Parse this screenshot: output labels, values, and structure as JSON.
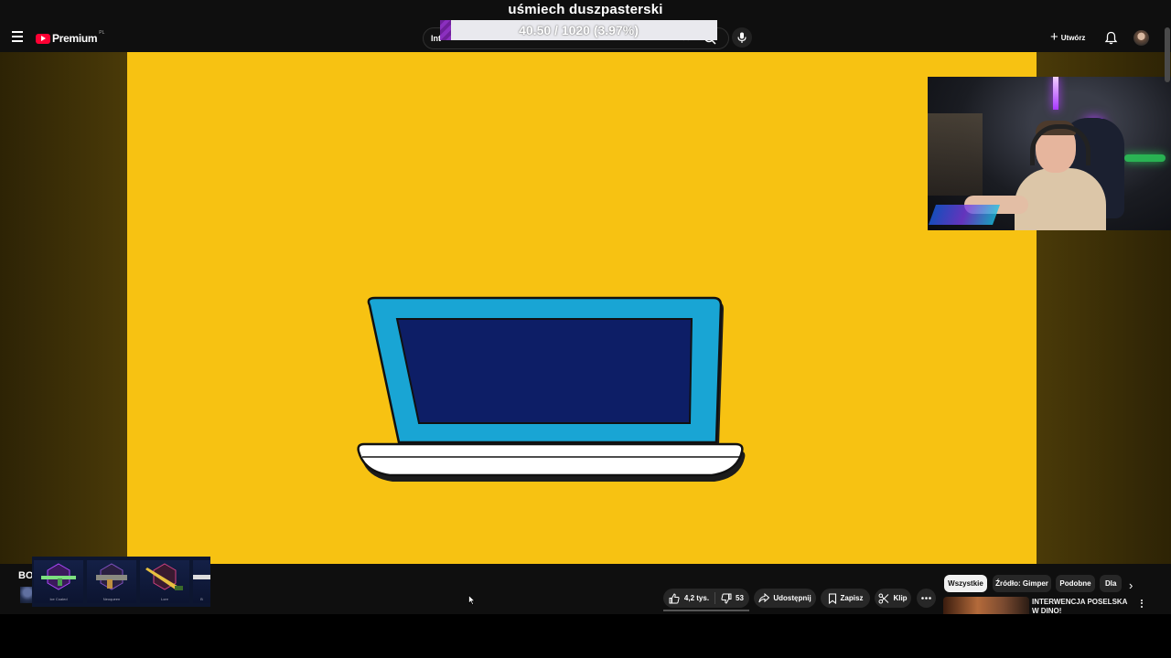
{
  "overlay": {
    "title": "uśmiech duszpasterski",
    "goal_text": "40.50 / 1020 (3.97%)",
    "goal_fraction": 0.0397,
    "goal_fill_color": "#7b2aa9"
  },
  "header": {
    "logo_text": "Premium",
    "logo_region": "PL",
    "search_value": "Int",
    "create_label": "Utwórz"
  },
  "video": {
    "background_color": "#f7c212"
  },
  "channel": {
    "name_partial": "BO"
  },
  "skins": [
    {
      "label": "Ice Coaled"
    },
    {
      "label": "Neoqueen"
    },
    {
      "label": "Lore"
    },
    {
      "label": "B"
    }
  ],
  "actions": {
    "like_count": "4,2 tys.",
    "dislike_count": "53",
    "share_label": "Udostępnij",
    "save_label": "Zapisz",
    "clip_label": "Klip"
  },
  "chips": {
    "all": "Wszystkie",
    "source": "Źródło: Gimper",
    "related": "Podobne",
    "for_you": "Dla"
  },
  "recommendation": {
    "title": "INTERWENCJA POSELSKA W DINO!"
  }
}
